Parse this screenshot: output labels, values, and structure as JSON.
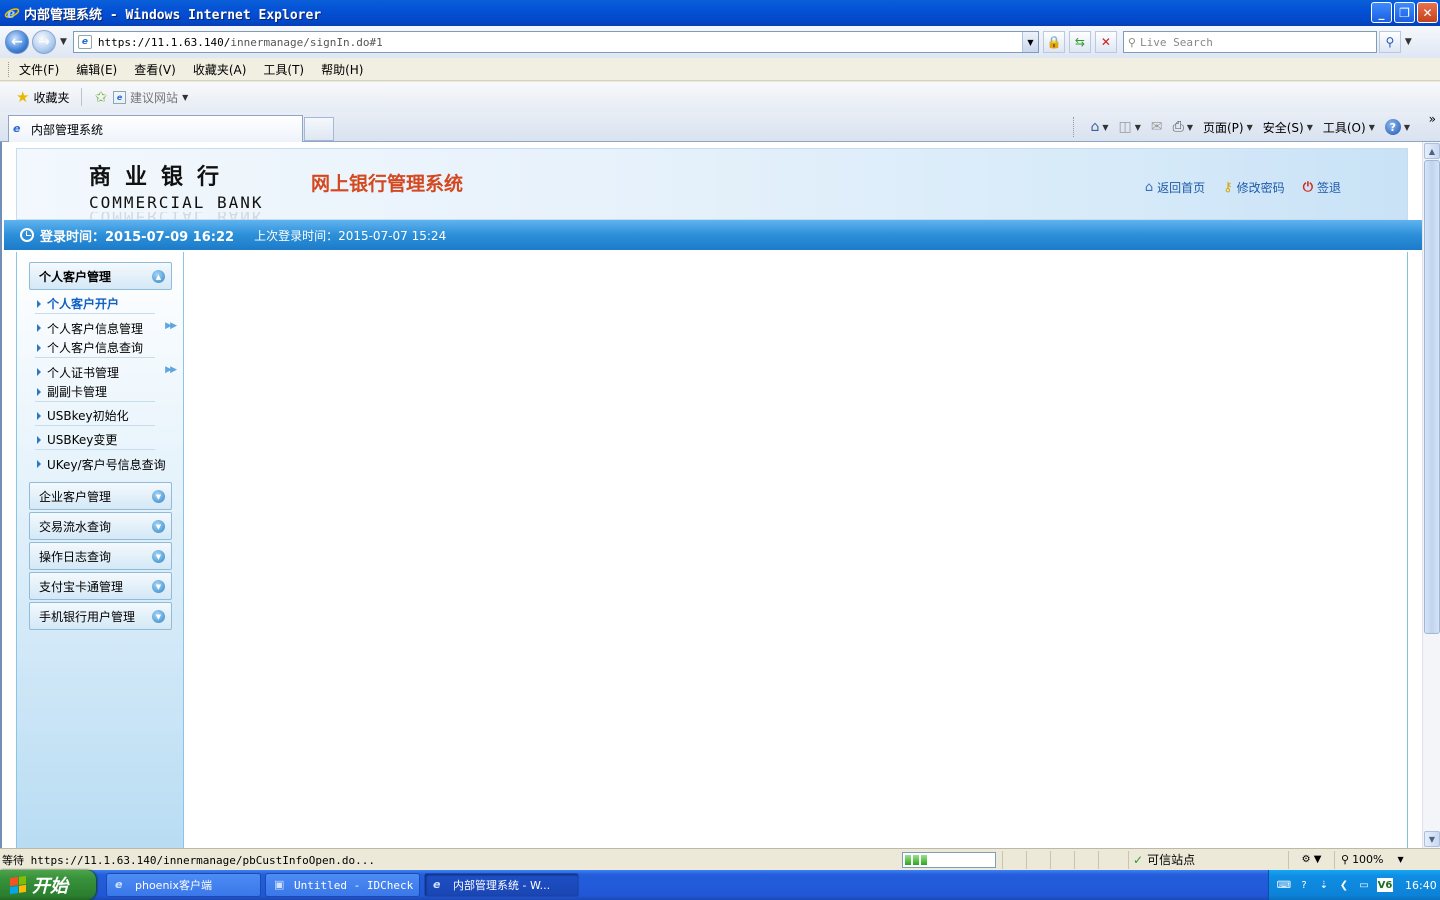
{
  "window": {
    "title": "内部管理系统 - Windows Internet Explorer",
    "min_glyph": "_",
    "max_glyph": "❐",
    "close_glyph": "✕"
  },
  "address": {
    "url_host": "https://11.1.63.140/",
    "url_path": "innermanage/signIn.do#1",
    "search_placeholder": "Live Search"
  },
  "menu": [
    "文件(F)",
    "编辑(E)",
    "查看(V)",
    "收藏夹(A)",
    "工具(T)",
    "帮助(H)"
  ],
  "favorites": {
    "label": "收藏夹",
    "suggested": "建议网站"
  },
  "tabs": {
    "active": "内部管理系统"
  },
  "commandbar": {
    "page": "页面(P)",
    "safety": "安全(S)",
    "tools": "工具(O)",
    "help": "?"
  },
  "bank": {
    "logo_cn": "商业银行",
    "logo_en": "COMMERCIAL BANK",
    "system_title": "网上银行管理系统",
    "links": {
      "home": "返回首页",
      "change_password": "修改密码",
      "logout": "签退"
    }
  },
  "login": {
    "current": "登录时间：2015-07-09 16:22",
    "previous": "上次登录时间：2015-07-07 15:24"
  },
  "nav": {
    "personal": {
      "label": "个人客户管理",
      "items": [
        "个人客户开户",
        "个人客户信息管理",
        "个人客户信息查询",
        "个人证书管理",
        "副副卡管理",
        "USBkey初始化",
        "USBKey变更",
        "UKey/客户号信息查询"
      ]
    },
    "sections": [
      "企业客户管理",
      "交易流水查询",
      "操作日志查询",
      "支付宝卡通管理",
      "手机银行用户管理"
    ]
  },
  "status": {
    "text": "等待 https://11.1.63.140/innermanage/pbCustInfoOpen.do...",
    "progress": 0.3,
    "zone": "可信站点",
    "zoom": "100%"
  },
  "taskbar": {
    "start": "开始",
    "items": [
      "phoenix客户端",
      "Untitled - IDCheck",
      "内部管理系统 - W..."
    ],
    "clock": "16:40",
    "tray_badge": "V6"
  },
  "colors": {
    "accent": "#2c8fd9",
    "title_red": "#d4481f",
    "link_blue": "#1e5aa8"
  }
}
